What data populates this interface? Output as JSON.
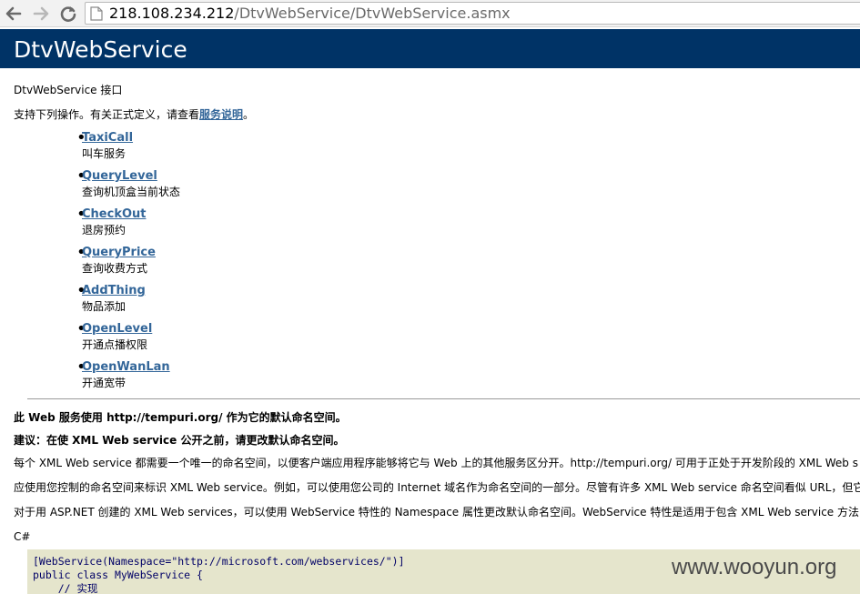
{
  "browser": {
    "url_host": "218.108.234.212",
    "url_path": "/DtvWebService/DtvWebService.asmx"
  },
  "header": {
    "title": "DtvWebService"
  },
  "intro": {
    "service_desc": "DtvWebService 接口",
    "ops_prefix": "支持下列操作。有关正式定义，请查看",
    "service_link": "服务说明",
    "ops_suffix": "。"
  },
  "operations": [
    {
      "name": "TaxiCall",
      "desc": "叫车服务"
    },
    {
      "name": "QueryLevel",
      "desc": "查询机顶盒当前状态"
    },
    {
      "name": "CheckOut",
      "desc": "退房预约"
    },
    {
      "name": "QueryPrice",
      "desc": "查询收费方式"
    },
    {
      "name": "AddThing",
      "desc": "物品添加"
    },
    {
      "name": "OpenLevel",
      "desc": "开通点播权限"
    },
    {
      "name": "OpenWanLan",
      "desc": "开通宽带"
    }
  ],
  "namespace_notice": {
    "line1": "此 Web 服务使用 http://tempuri.org/ 作为它的默认命名空间。",
    "line2": "建议：在使 XML Web service 公开之前，请更改默认命名空间。",
    "para1": "每个 XML Web service 都需要一个唯一的命名空间，以便客户端应用程序能够将它与 Web 上的其他服务区分开。http://tempuri.org/ 可用于正处于开发阶段的 XML Web s",
    "para2": "应使用您控制的命名空间来标识 XML Web service。例如，可以使用您公司的 Internet 域名作为命名空间的一部分。尽管有许多 XML Web service 命名空间看似 URL，但它",
    "para3": "对于用 ASP.NET 创建的 XML Web services，可以使用 WebService 特性的 Namespace 属性更改默认命名空间。WebService 特性是适用于包含 XML Web service 方法的",
    "lang_label": "C#"
  },
  "code": {
    "line1": "[WebService(Namespace=\"http://microsoft.com/webservices/\")]",
    "line2": "public class MyWebService {",
    "line3": "    // 实现"
  },
  "watermark": "www.wooyun.org",
  "colors": {
    "header_bg": "#003366",
    "link": "#336699",
    "code_bg": "#e5e5cc"
  }
}
